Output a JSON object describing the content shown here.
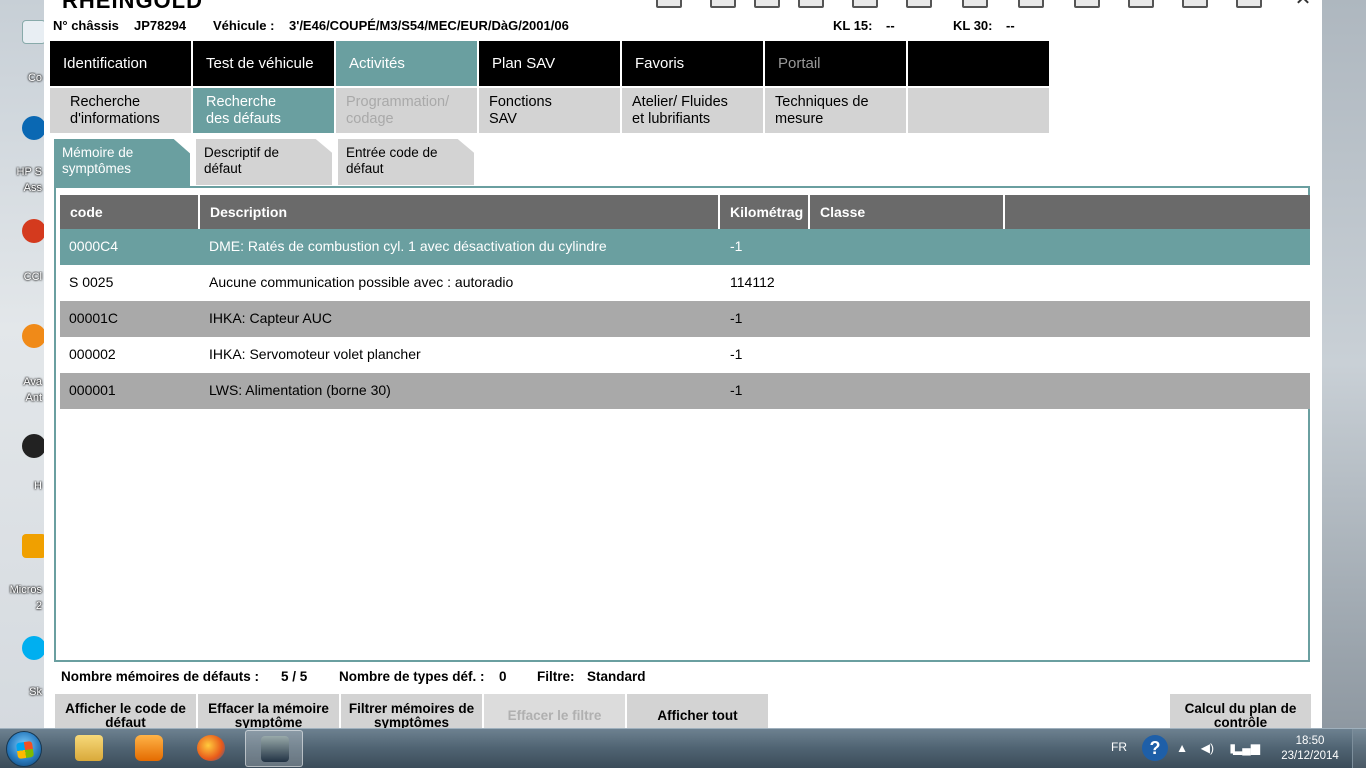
{
  "app": {
    "title": "RHEINGOLD"
  },
  "info": {
    "chassis_label": "N° châssis",
    "chassis_value": "JP78294",
    "vehicle_label": "Véhicule :",
    "vehicle_value": "3'/E46/COUPÉ/M3/S54/MEC/EUR/DàG/2001/06",
    "kl15_label": "KL 15:",
    "kl15_value": "--",
    "kl30_label": "KL 30:",
    "kl30_value": "--"
  },
  "nav_main": [
    {
      "label": "Identification",
      "state": "normal"
    },
    {
      "label": "Test de véhicule",
      "state": "normal"
    },
    {
      "label": "Activités",
      "state": "active"
    },
    {
      "label": "Plan SAV",
      "state": "normal"
    },
    {
      "label": "Favoris",
      "state": "normal"
    },
    {
      "label": "Portail",
      "state": "disabled"
    },
    {
      "label": "",
      "state": "normal"
    }
  ],
  "nav_sub": [
    {
      "line1": "Recherche",
      "line2": "d'informations",
      "state": "normal"
    },
    {
      "line1": "Recherche",
      "line2": "des défauts",
      "state": "active"
    },
    {
      "line1": "Programmation/",
      "line2": "codage",
      "state": "disabled"
    },
    {
      "line1": "Fonctions",
      "line2": "SAV",
      "state": "normal"
    },
    {
      "line1": "Atelier/ Fluides",
      "line2": "et lubrifiants",
      "state": "normal"
    },
    {
      "line1": "Techniques de",
      "line2": "mesure",
      "state": "normal"
    },
    {
      "line1": "",
      "line2": "",
      "state": "normal"
    }
  ],
  "sub_tabs": [
    {
      "line1": "Mémoire de",
      "line2": "symptômes",
      "state": "active"
    },
    {
      "line1": "Descriptif de",
      "line2": "défaut",
      "state": "normal"
    },
    {
      "line1": "Entrée code de",
      "line2": "défaut",
      "state": "normal"
    }
  ],
  "table": {
    "headers": [
      "code",
      "Description",
      "Kilométrag",
      "Classe",
      ""
    ],
    "rows": [
      {
        "code": "0000C4",
        "description": "DME: Ratés de combustion cyl. 1 avec désactivation du cylindre",
        "km": "-1",
        "classe": "",
        "selected": true
      },
      {
        "code": "S 0025",
        "description": "Aucune communication possible avec : autoradio",
        "km": "114112",
        "classe": "",
        "selected": false
      },
      {
        "code": "00001C",
        "description": "IHKA: Capteur AUC",
        "km": "-1",
        "classe": "",
        "selected": false
      },
      {
        "code": "000002",
        "description": "IHKA: Servomoteur volet plancher",
        "km": "-1",
        "classe": "",
        "selected": false
      },
      {
        "code": "000001",
        "description": "LWS: Alimentation (borne 30)",
        "km": "-1",
        "classe": "",
        "selected": false
      }
    ]
  },
  "stats": {
    "count_label": "Nombre mémoires de défauts :",
    "count_value": "5 / 5",
    "types_label": "Nombre de types déf. :",
    "types_value": "0",
    "filter_label": "Filtre:",
    "filter_value": "Standard"
  },
  "actions": [
    {
      "line1": "Afficher le code de",
      "line2": "défaut",
      "state": "normal"
    },
    {
      "line1": "Effacer la mémoire",
      "line2": "symptôme",
      "state": "normal"
    },
    {
      "line1": "Filtrer mémoires de",
      "line2": "symptômes",
      "state": "normal"
    },
    {
      "line1": "Effacer le filtre",
      "line2": "",
      "state": "disabled"
    },
    {
      "line1": "Afficher tout",
      "line2": "",
      "state": "normal"
    }
  ],
  "action_right": {
    "line1": "Calcul du plan de",
    "line2": "contrôle"
  },
  "desktop_icons": [
    {
      "label": "Co",
      "icon": "computer-icon"
    },
    {
      "label": "HP S",
      "icon": "hp-support-icon"
    },
    {
      "label": "Ass",
      "icon": "hp-support-icon"
    },
    {
      "label": "CCl",
      "icon": "ccleaner-icon"
    },
    {
      "label": "Ava",
      "icon": "avast-icon"
    },
    {
      "label": "Ant",
      "icon": "avast-icon"
    },
    {
      "label": "H",
      "icon": "hp-icon"
    },
    {
      "label": "Micros",
      "icon": "microsoft-icon"
    },
    {
      "label": "2",
      "icon": "microsoft-icon"
    },
    {
      "label": "Sk",
      "icon": "skype-icon"
    }
  ],
  "taskbar": {
    "items": [
      "explorer-icon",
      "media-player-icon",
      "firefox-icon",
      "ista-app-icon"
    ],
    "lang": "FR",
    "time": "18:50",
    "date": "23/12/2014"
  }
}
